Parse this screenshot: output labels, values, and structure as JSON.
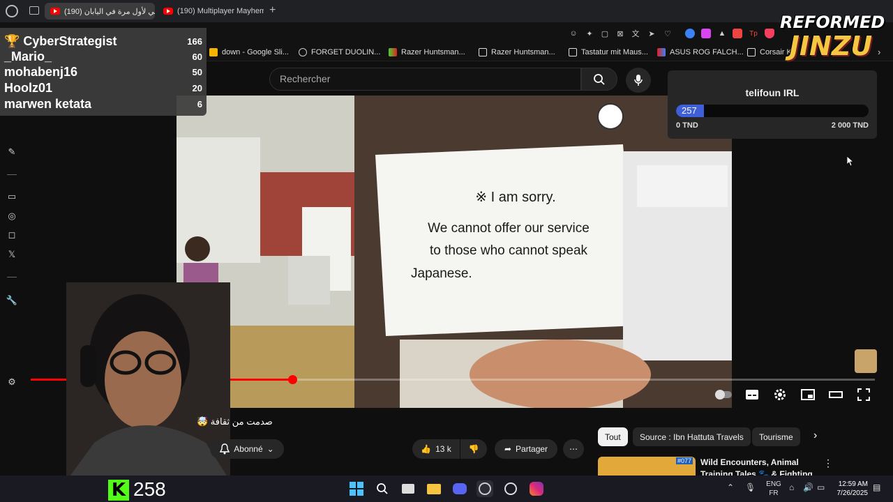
{
  "browser": {
    "tabs": [
      {
        "label": "(190) عربي لأول مرة في اليابان",
        "active": true
      },
      {
        "label": "(190) Multiplayer Mayhem",
        "active": false
      }
    ],
    "new_tab": "+"
  },
  "bookmarks": [
    {
      "label": "down - Google Sli...",
      "color": "#f4b400"
    },
    {
      "label": "FORGET DUOLIN...",
      "color": "#cccccc"
    },
    {
      "label": "Razer Huntsman...",
      "color": "#44d62c"
    },
    {
      "label": "Razer Huntsman...",
      "color": "#dddddd"
    },
    {
      "label": "Tastatur mit Maus...",
      "color": "#dddddd"
    },
    {
      "label": "ASUS ROG FALCH...",
      "color": "#e02020"
    },
    {
      "label": "Corsair K",
      "color": "#dddddd"
    }
  ],
  "youtube": {
    "search_placeholder": "Rechercher",
    "video_title": "صدمت من ثقافة 🤯",
    "subscribe_label": "Abonné",
    "likes": "13 k",
    "share_label": "Partager",
    "more": "⋯",
    "chips": [
      "Tout",
      "Source : Ibn Hattuta Travels",
      "Tourisme"
    ],
    "recommendation": {
      "title": "Wild Encounters, Animal",
      "title2": "Training Tales 🐾 & Fighting",
      "badge": "#077"
    },
    "video_sign": {
      "line1": "※ I am sorry.",
      "line2": "We cannot offer our service",
      "line3": "to those who cannot speak",
      "line4": "Japanese."
    },
    "progress": 0.31
  },
  "leaderboard": [
    {
      "name": "CyberStrategist",
      "score": "166"
    },
    {
      "name": "_Mario_",
      "score": "60"
    },
    {
      "name": "mohabenj16",
      "score": "50"
    },
    {
      "name": "Hoolz01",
      "score": "20"
    },
    {
      "name": "marwen ketata",
      "score": "6"
    }
  ],
  "goal": {
    "title": "telifoun IRL",
    "current": "257",
    "min": "0 TND",
    "max": "2 000 TND",
    "fill": 0.1285,
    "color": "#3f5ed9"
  },
  "brand": {
    "line1": "REFORMED",
    "line2": "JINZU"
  },
  "kick": {
    "logo": "K",
    "viewers": "258"
  },
  "taskbar": {
    "lang1": "ENG",
    "lang2": "FR",
    "time": "12:59 AM",
    "date": "7/26/2025"
  }
}
